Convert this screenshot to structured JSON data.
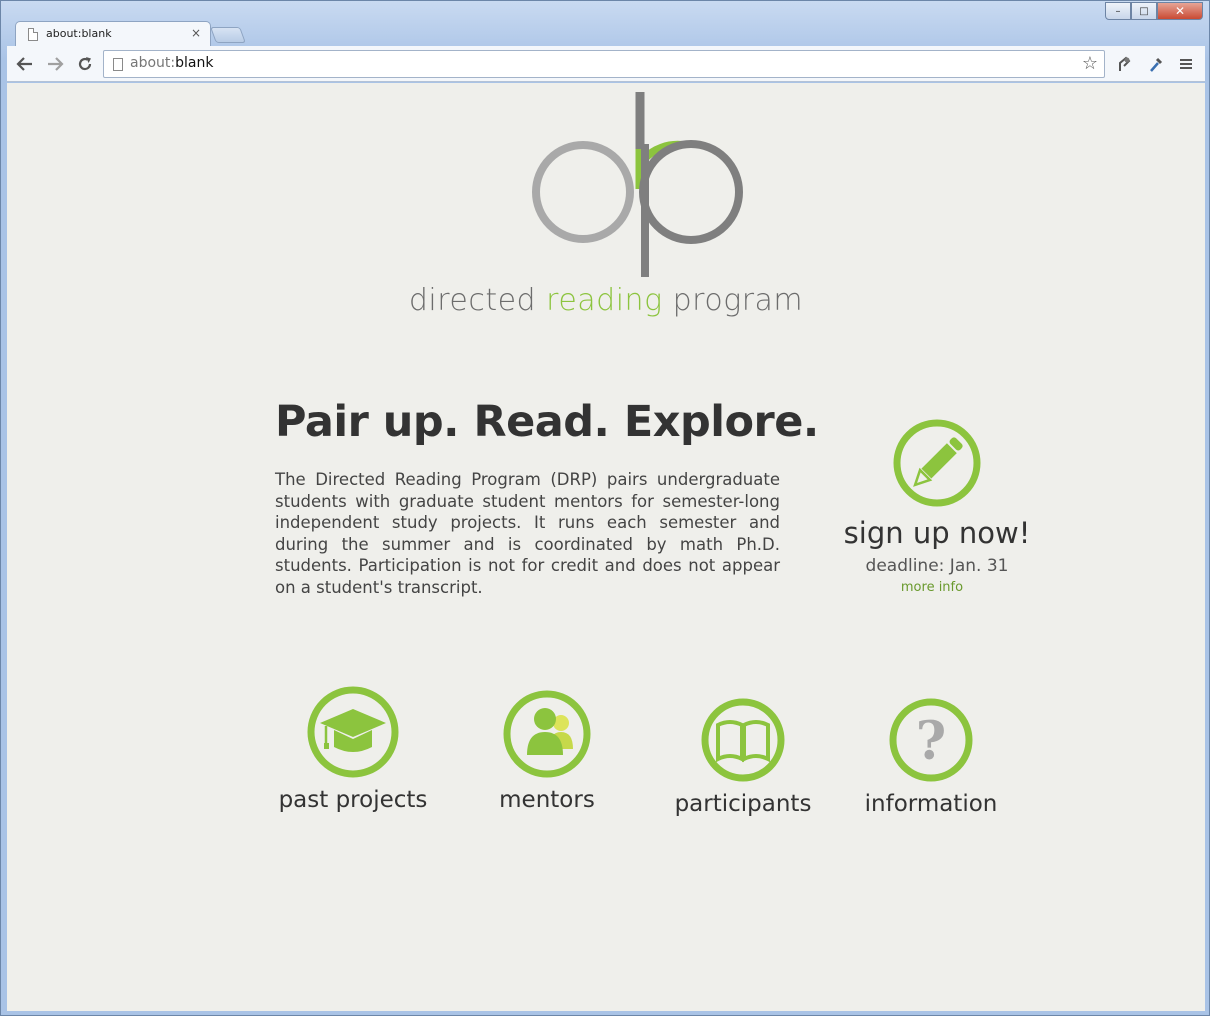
{
  "browser": {
    "tab_title": "about:blank",
    "tab_close": "×",
    "url_prefix": "about:",
    "url_host": "blank",
    "window_controls": [
      "–",
      "□",
      "✕"
    ]
  },
  "logo": {
    "word1": "directed",
    "word2": "reading",
    "word3": "program",
    "colors": {
      "gray_light": "#a9a9a9",
      "gray_dark": "#7f7f7f",
      "green": "#8cc43e"
    }
  },
  "headline": "Pair up. Read. Explore.",
  "intro": "The Directed Reading Program (DRP) pairs undergraduate students with graduate student mentors for semester-long independent study projects. It runs each semester and during the summer and is coordinated by math Ph.D. students. Participation is not for credit and does not appear on a student's transcript.",
  "signup": {
    "title": "sign up now!",
    "deadline": "deadline: Jan. 31",
    "more": "more info",
    "icon": "pencil-icon"
  },
  "tiles": [
    {
      "label": "past projects",
      "icon": "graduation-cap-icon"
    },
    {
      "label": "mentors",
      "icon": "people-icon"
    },
    {
      "label": "participants",
      "icon": "open-book-icon"
    },
    {
      "label": "information",
      "icon": "question-mark-icon"
    }
  ],
  "accent_color": "#8cc43e"
}
